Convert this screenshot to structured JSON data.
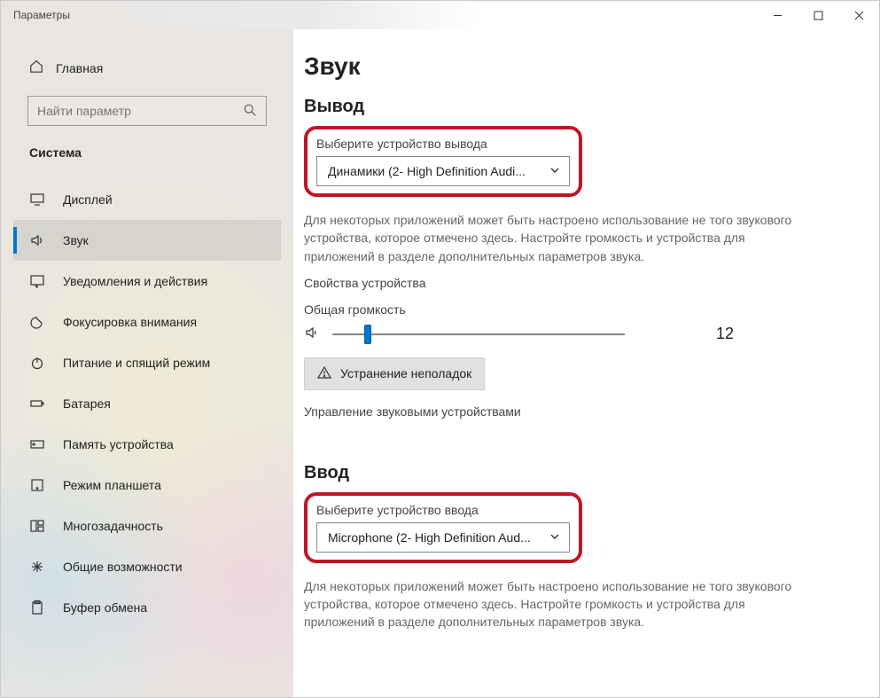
{
  "window": {
    "title": "Параметры"
  },
  "sidebar": {
    "home_label": "Главная",
    "search_placeholder": "Найти параметр",
    "category": "Система",
    "items": [
      {
        "label": "Дисплей"
      },
      {
        "label": "Звук"
      },
      {
        "label": "Уведомления и действия"
      },
      {
        "label": "Фокусировка внимания"
      },
      {
        "label": "Питание и спящий режим"
      },
      {
        "label": "Батарея"
      },
      {
        "label": "Память устройства"
      },
      {
        "label": "Режим планшета"
      },
      {
        "label": "Многозадачность"
      },
      {
        "label": "Общие возможности"
      },
      {
        "label": "Буфер обмена"
      }
    ]
  },
  "main": {
    "page_title": "Звук",
    "output": {
      "section_title": "Вывод",
      "choose_label": "Выберите устройство вывода",
      "selected": "Динамики (2- High Definition Audi...",
      "help": "Для некоторых приложений может быть настроено использование не того звукового устройства, которое отмечено здесь. Настройте громкость и устройства для приложений в разделе дополнительных параметров звука.",
      "properties_link": "Свойства устройства",
      "volume_label": "Общая громкость",
      "volume_value": "12",
      "troubleshoot_btn": "Устранение неполадок",
      "manage_link": "Управление звуковыми устройствами"
    },
    "input": {
      "section_title": "Ввод",
      "choose_label": "Выберите устройство ввода",
      "selected": "Microphone (2- High Definition Aud...",
      "help": "Для некоторых приложений может быть настроено использование не того звукового устройства, которое отмечено здесь. Настройте громкость и устройства для приложений в разделе дополнительных параметров звука."
    }
  }
}
